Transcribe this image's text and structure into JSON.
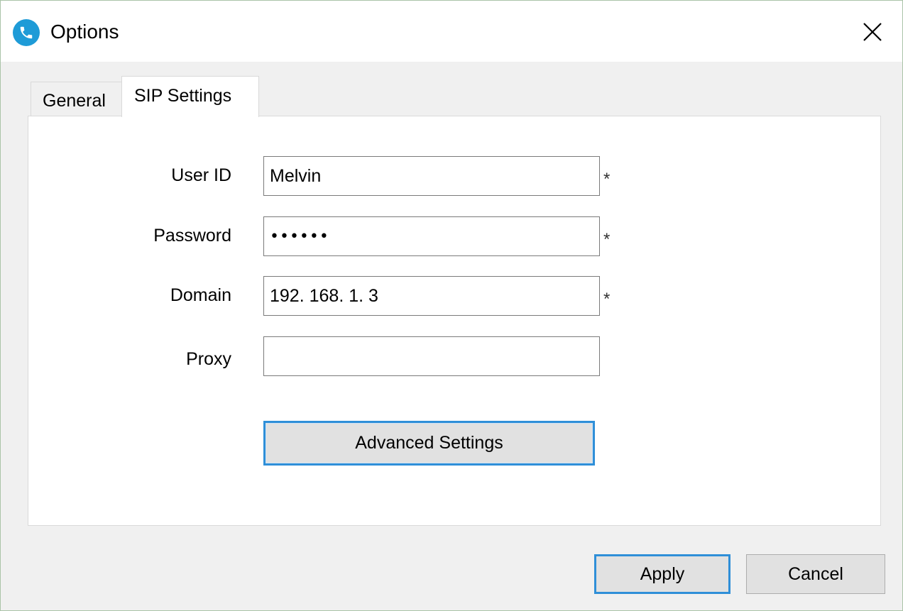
{
  "window": {
    "title": "Options",
    "app_icon": "phone-icon",
    "close_icon": "close-icon"
  },
  "tabs": [
    {
      "label": "General",
      "selected": false
    },
    {
      "label": "SIP Settings",
      "selected": true
    }
  ],
  "form": {
    "user_id": {
      "label": "User ID",
      "value": "Melvin",
      "required_mark": "*"
    },
    "password": {
      "label": "Password",
      "value": "••••••",
      "required_mark": "*"
    },
    "domain": {
      "label": "Domain",
      "value": "192. 168. 1. 3",
      "required_mark": "*"
    },
    "proxy": {
      "label": "Proxy",
      "value": ""
    }
  },
  "buttons": {
    "advanced_settings": "Advanced Settings",
    "apply": "Apply",
    "cancel": "Cancel"
  },
  "colors": {
    "accent": "#2f8fd8",
    "app_icon": "#1e9bd7",
    "window_border": "#aac4a8"
  }
}
